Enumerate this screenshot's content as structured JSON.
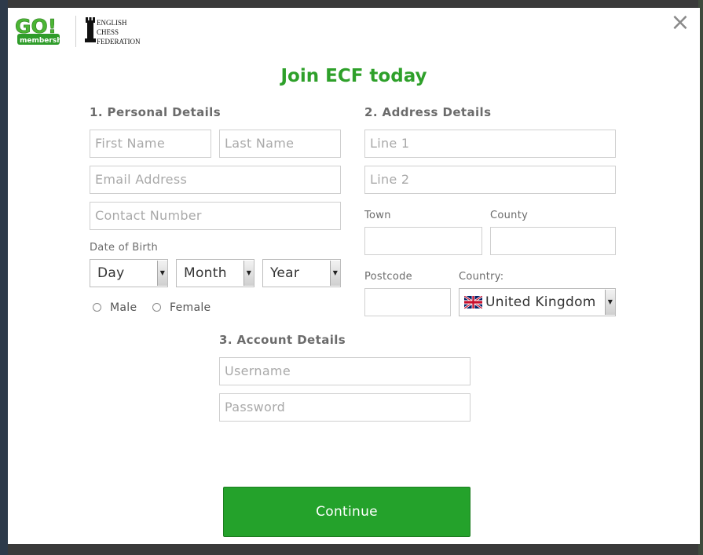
{
  "header": {
    "logo_go_text": "GO!",
    "logo_membership_text": "membership",
    "ecf_logo_lines": [
      "ENGLISH",
      "CHESS",
      "FEDERATION"
    ],
    "close_glyph": "×"
  },
  "title": "Join ECF today",
  "personal": {
    "heading": "1. Personal Details",
    "first_name_placeholder": "First Name",
    "last_name_placeholder": "Last Name",
    "email_placeholder": "Email Address",
    "contact_placeholder": "Contact Number",
    "dob_label": "Date of Birth",
    "day": "Day",
    "month": "Month",
    "year": "Year",
    "gender_male": "Male",
    "gender_female": "Female"
  },
  "address": {
    "heading": "2. Address Details",
    "line1_placeholder": "Line 1",
    "line2_placeholder": "Line 2",
    "town_label": "Town",
    "county_label": "County",
    "postcode_label": "Postcode",
    "country_label": "Country:",
    "country_value": "United Kingdom",
    "country_flag_icon": "uk-flag-icon"
  },
  "account": {
    "heading": "3. Account Details",
    "username_placeholder": "Username",
    "password_placeholder": "Password"
  },
  "continue_label": "Continue",
  "colors": {
    "accent": "#2ea02a",
    "button": "#24a22b",
    "heading_text": "#6b6b6b",
    "placeholder": "#a9a9a9"
  }
}
